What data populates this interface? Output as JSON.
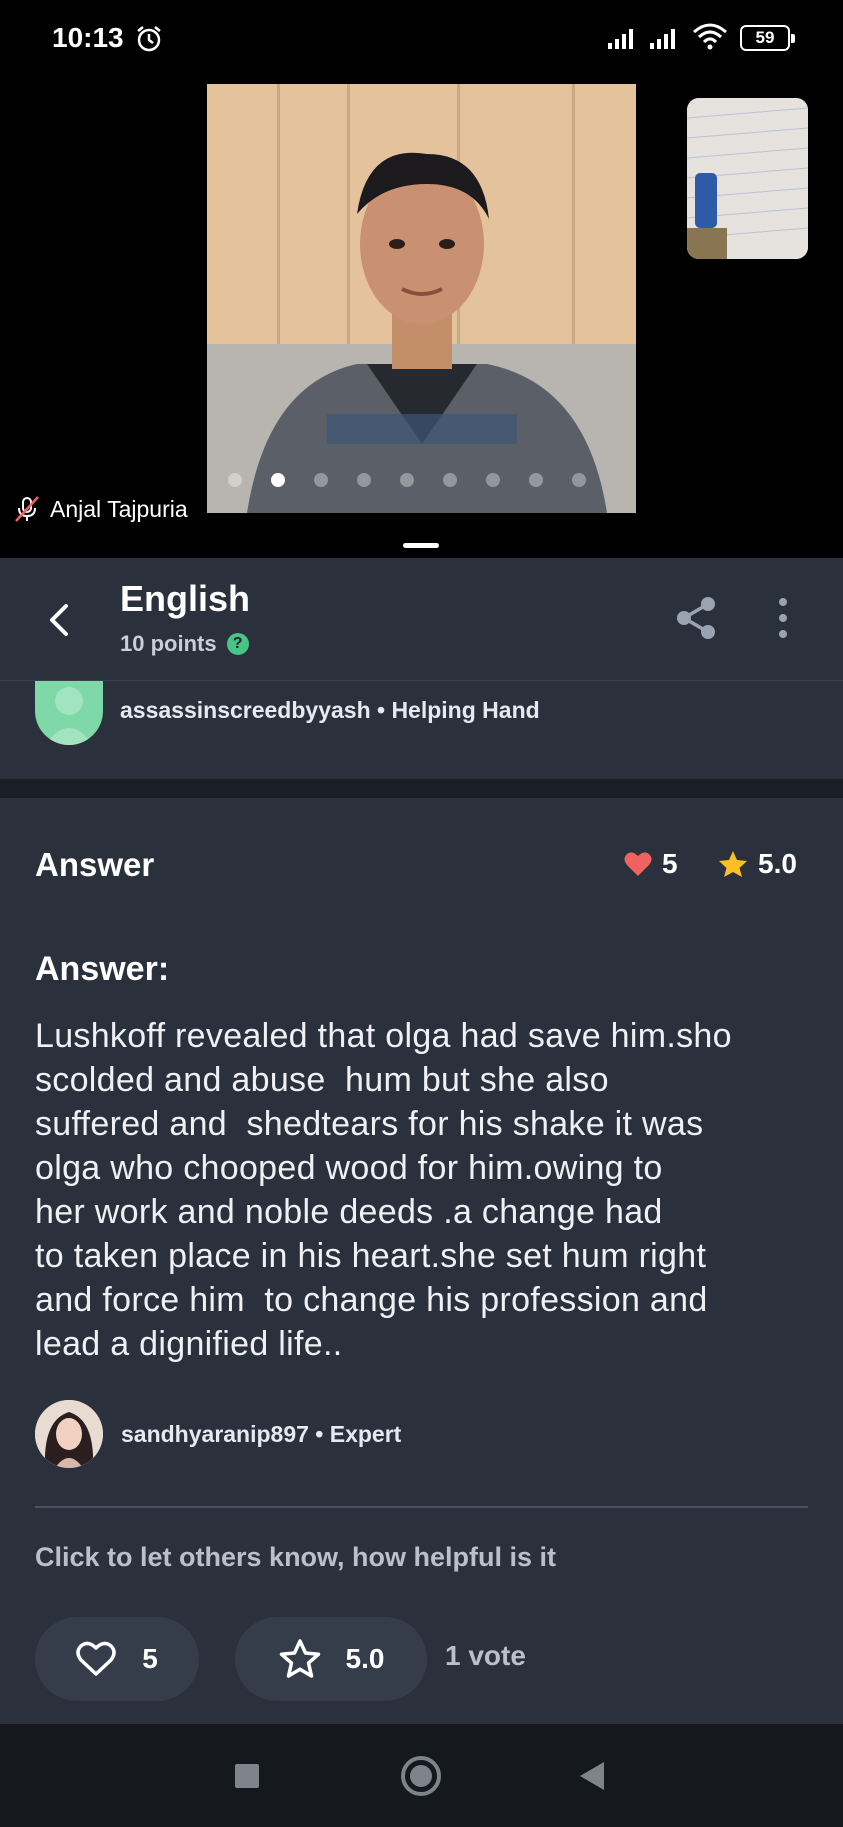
{
  "status_bar": {
    "time": "10:13",
    "battery": "59",
    "icons": [
      "alarm-icon",
      "signal-icon",
      "signal-icon",
      "wifi-icon",
      "battery-icon"
    ]
  },
  "video_call": {
    "caller_name": "Anjal Tajpuria",
    "caller_icon": "mic-off-icon",
    "page_dots": 9,
    "active_dot": 1
  },
  "header": {
    "title": "English",
    "points": "10 points",
    "help_icon": "?",
    "icons": [
      "back-icon",
      "share-icon",
      "more-vert-icon"
    ]
  },
  "asker": {
    "line": "assassinscreedbyyash • Helping Hand"
  },
  "answer": {
    "heading": "Answer",
    "likes": "5",
    "rating": "5.0",
    "subheading": "Answer:",
    "body_lines": [
      "Lushkoff revealed that olga had save him.sho",
      "scolded and abuse  hum but she also",
      "suffered and  shedtears for his shake it was",
      "olga who chooped wood for him.owing to",
      "her work and noble deeds .a change had",
      "to taken place in his heart.she set hum right",
      "and force him  to change his profession and",
      "lead a dignified life.."
    ],
    "expert_line": "sandhyaranip897 • Expert",
    "helpful_prompt": "Click to let others know, how helpful is it",
    "like_count": "5",
    "rate_value": "5.0",
    "votes": "1 vote"
  },
  "colors": {
    "card_bg": "#2b313c",
    "heart": "#f0625f",
    "star": "#fbbf24",
    "help_green": "#49c486"
  }
}
